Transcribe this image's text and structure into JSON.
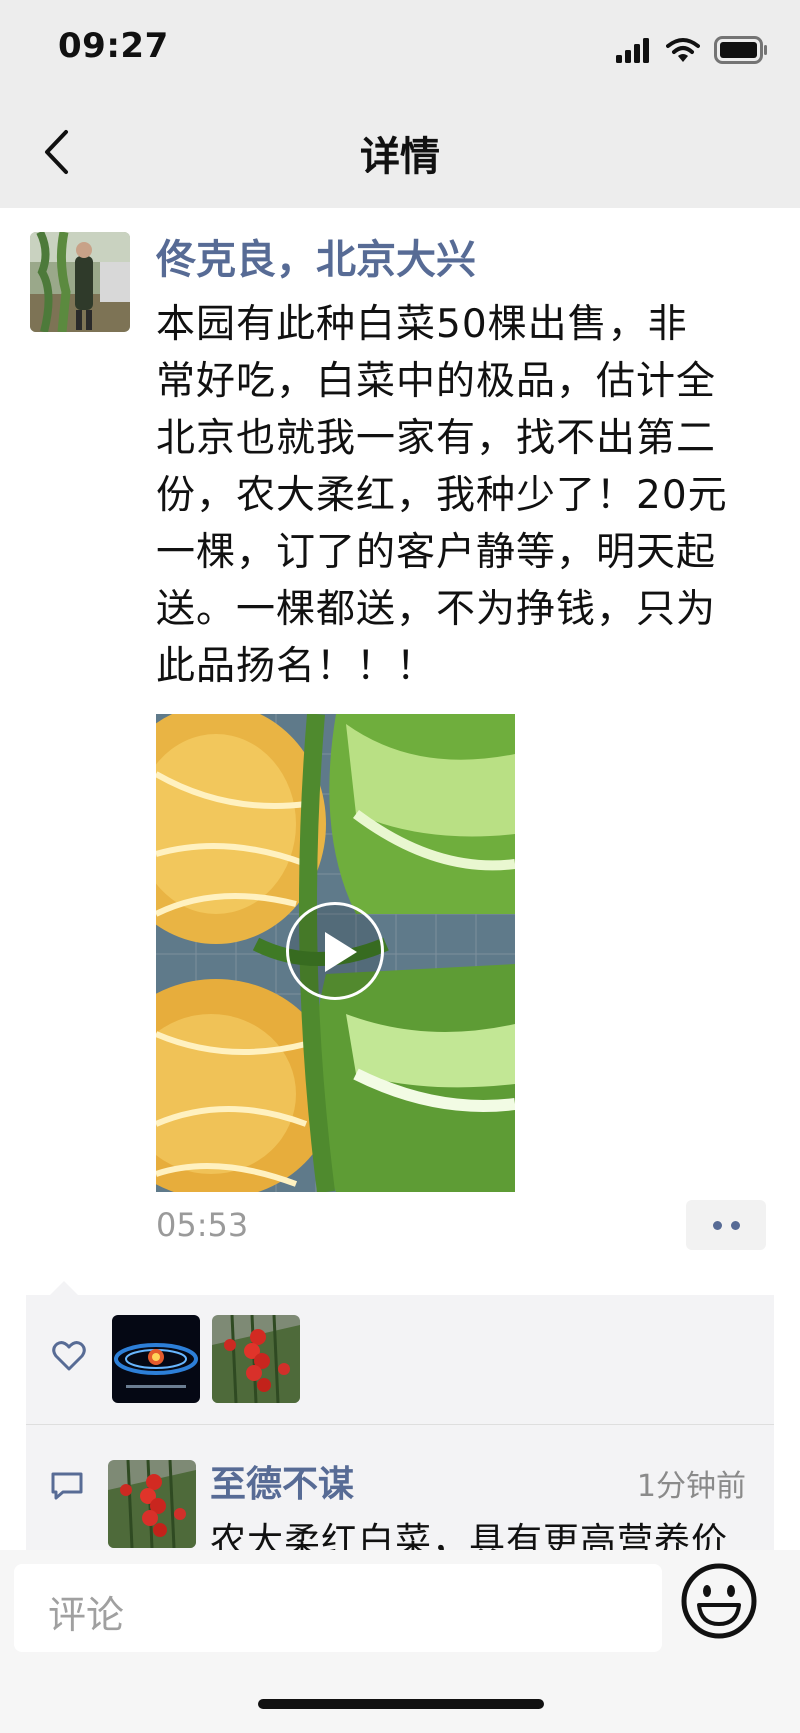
{
  "status": {
    "time": "09:27"
  },
  "nav": {
    "title": "详情"
  },
  "post": {
    "author": "佟克良，北京大兴",
    "lines": [
      "本园有此种白菜50棵出售，非",
      "常好吃，白菜中的极品，估计全",
      "北京也就我一家有，找不出第二",
      "份，农大柔红，我种少了！20元",
      "一棵，订了的客户静等，明天起",
      "送。一棵都送，不为挣钱，只为",
      "此品扬名！！！"
    ],
    "time": "05:53"
  },
  "comment": {
    "name": "至德不谋",
    "time": "1分钟前",
    "text": "农大柔红白菜，具有更高营养价"
  },
  "input": {
    "placeholder": "评论"
  },
  "colors": {
    "link": "#576b95",
    "panel": "#f3f3f5",
    "nav": "#ededed"
  }
}
